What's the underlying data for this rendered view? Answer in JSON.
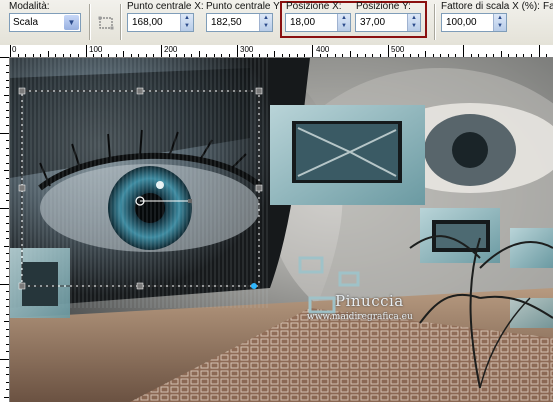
{
  "toolbar": {
    "mode": {
      "label": "Modalità:",
      "value": "Scala"
    },
    "center_x": {
      "label": "Punto centrale X:",
      "value": "168,00"
    },
    "center_y": {
      "label": "Punto centrale Y:",
      "value": "182,50"
    },
    "pos_x": {
      "label": "Posizione X:",
      "value": "18,00"
    },
    "pos_y": {
      "label": "Posizione Y:",
      "value": "37,00"
    },
    "scale_x": {
      "label": "Fattore di scala X (%):",
      "value": "100,00"
    },
    "next_label_fragment": "Fa",
    "highlight_color": "#8a1010"
  },
  "ruler_top": [
    "0",
    "100",
    "200",
    "300",
    "400",
    "500"
  ],
  "watermark": {
    "line1": "Pinuccia",
    "line2": "www.maidiregrafica.eu"
  },
  "icons": {
    "dropdown": "chevron-down-icon",
    "tool": "pick-tool-icon",
    "spin": "spin-arrows-icon"
  }
}
